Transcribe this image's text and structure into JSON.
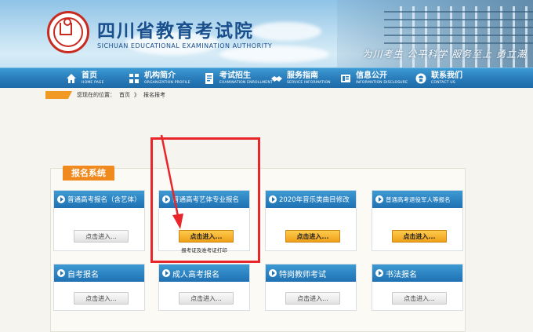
{
  "header": {
    "site_title": "四川省教育考试院",
    "site_subtitle": "SICHUAN EDUCATIONAL EXAMINATION AUTHORITY",
    "slogan": "为川考生  公平科学  服务至上  勇立潮"
  },
  "nav": [
    {
      "cn": "首页",
      "en": "HOME PAGE",
      "icon": "home-icon"
    },
    {
      "cn": "机构简介",
      "en": "ORGANIZATION PROFILE",
      "icon": "org-chart-icon"
    },
    {
      "cn": "考试招生",
      "en": "EXAMINATION ENROLLMENT",
      "icon": "document-icon"
    },
    {
      "cn": "服务指南",
      "en": "SERVICE INFORMATION",
      "icon": "handshake-icon"
    },
    {
      "cn": "信息公开",
      "en": "INFORMATION DISCLOSURE",
      "icon": "info-icon"
    },
    {
      "cn": "联系我们",
      "en": "CONTACT US",
      "icon": "contact-icon"
    }
  ],
  "breadcrumb": {
    "prefix": "您现在的位置：",
    "home": "首页",
    "sep": "》",
    "current": "报名报考"
  },
  "panel": {
    "tab_label": "报名系统"
  },
  "cards_row1": [
    {
      "title": "普通高考报名（含艺体）",
      "button": "点击进入...",
      "highlight": false,
      "note": ""
    },
    {
      "title": "普通高考艺体专业报名",
      "button": "点击进入...",
      "highlight": true,
      "note": "报考证及准考证打印"
    },
    {
      "title": "2020年音乐类曲目修改",
      "button": "点击进入...",
      "highlight": true,
      "note": ""
    },
    {
      "title": "普通高考退役军人等报名",
      "button": "点击进入...",
      "highlight": true,
      "note": ""
    }
  ],
  "cards_row2": [
    {
      "title": "自考报名",
      "button": "点击进入..."
    },
    {
      "title": "成人高考报名",
      "button": "点击进入..."
    },
    {
      "title": "特岗教师考试",
      "button": "点击进入..."
    },
    {
      "title": "书法报名",
      "button": "点击进入..."
    }
  ],
  "colors": {
    "nav_blue": "#2a7dbb",
    "accent_orange": "#f08a1e",
    "highlight_red": "#e8252a",
    "title_blue": "#1a4f8d"
  }
}
